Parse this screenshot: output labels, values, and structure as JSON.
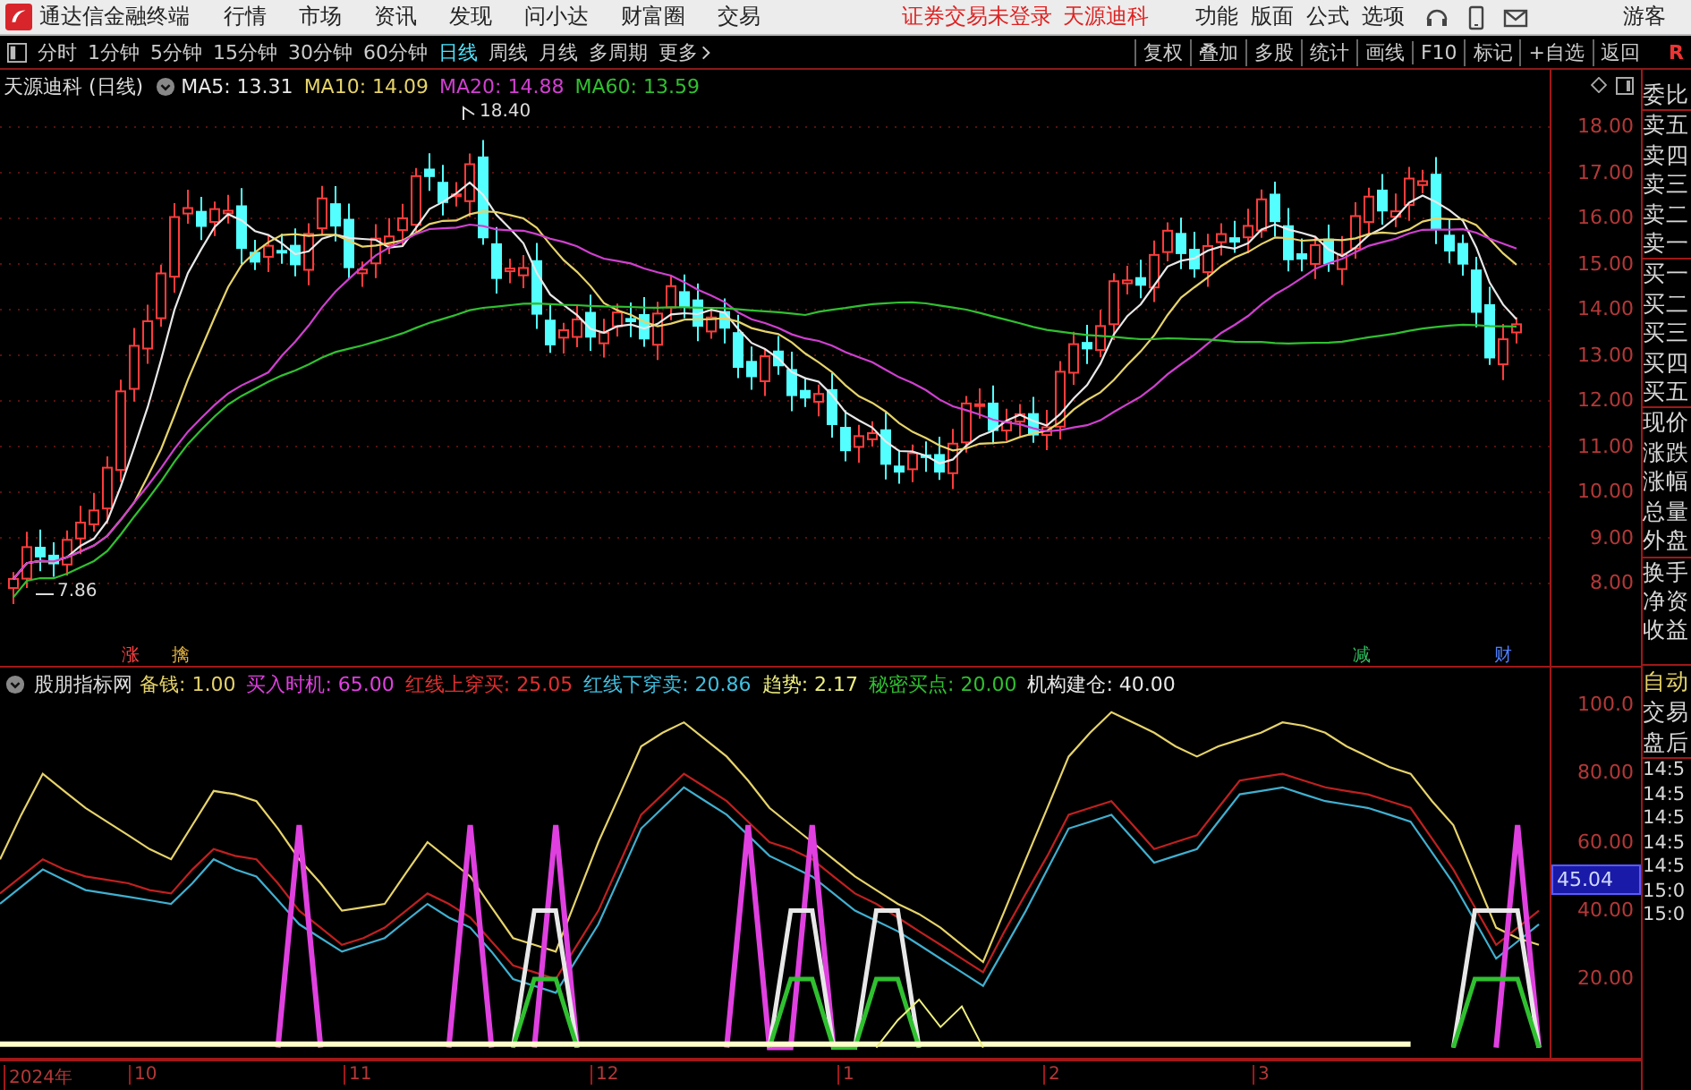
{
  "menu_bar": {
    "app_title": "通达信金融终端",
    "menus": [
      "行情",
      "市场",
      "资讯",
      "发现",
      "问小达",
      "财富圈",
      "交易"
    ],
    "notices": [
      "证券交易未登录",
      "天源迪科"
    ],
    "right_menus": [
      "功能",
      "版面",
      "公式",
      "选项"
    ],
    "user": "游客"
  },
  "period_bar": {
    "periods": [
      {
        "label": "分时",
        "selected": false
      },
      {
        "label": "1分钟",
        "selected": false
      },
      {
        "label": "5分钟",
        "selected": false
      },
      {
        "label": "15分钟",
        "selected": false
      },
      {
        "label": "30分钟",
        "selected": false
      },
      {
        "label": "60分钟",
        "selected": false
      },
      {
        "label": "日线",
        "selected": true
      },
      {
        "label": "周线",
        "selected": false
      },
      {
        "label": "月线",
        "selected": false
      },
      {
        "label": "多周期",
        "selected": false
      }
    ],
    "more": "更多",
    "tools": [
      "复权",
      "叠加",
      "多股",
      "统计",
      "画线",
      "F10",
      "标记",
      "+自选",
      "返回"
    ],
    "badge": "R"
  },
  "price_chart": {
    "title": "天源迪科 (日线)",
    "mas": [
      {
        "label": "MA5: 13.31",
        "color": "#e8e8e8"
      },
      {
        "label": "MA10: 14.09",
        "color": "#e6d36a"
      },
      {
        "label": "MA20: 14.88",
        "color": "#d040d0"
      },
      {
        "label": "MA60: 13.59",
        "color": "#30c030"
      }
    ],
    "high_label": "18.40",
    "low_label": "7.86",
    "y_ticks": [
      "18.00",
      "17.00",
      "16.00",
      "15.00",
      "14.00",
      "13.00",
      "12.00",
      "11.00",
      "10.00",
      "9.00",
      "8.00"
    ],
    "markers": [
      {
        "text": "涨",
        "color": "#ff4040"
      },
      {
        "text": "擒",
        "color": "#e0b040"
      },
      {
        "text": "减",
        "color": "#30c060"
      },
      {
        "text": "财",
        "color": "#5080ff"
      }
    ]
  },
  "indicator": {
    "title": "股朋指标网",
    "values": [
      {
        "label": "备钱: 1.00",
        "color": "#e6d36a"
      },
      {
        "label": "买入时机: 65.00",
        "color": "#e040e0"
      },
      {
        "label": "红线上穿买: 25.05",
        "color": "#e03030"
      },
      {
        "label": "红线下穿卖: 20.86",
        "color": "#40c0e0"
      },
      {
        "label": "趋势: 2.17",
        "color": "#f0f080"
      },
      {
        "label": "秘密买点: 20.00",
        "color": "#30c030"
      },
      {
        "label": "机构建仓: 40.00",
        "color": "#e8e8e8"
      }
    ],
    "current": "45.04",
    "chart_data": {
      "type": "line",
      "ylim": [
        -3,
        101.6
      ],
      "categories": [
        null,
        null,
        null,
        null,
        null,
        null,
        null,
        null,
        null,
        null,
        null,
        null,
        null,
        null,
        null,
        null,
        null,
        null,
        null,
        null,
        null,
        null,
        null,
        null,
        null,
        null,
        null,
        null,
        null,
        null,
        null,
        null,
        null,
        null,
        null,
        null,
        null,
        null,
        null,
        null,
        null,
        null,
        null,
        null,
        null,
        null,
        null,
        null,
        null,
        null,
        null,
        null,
        null,
        null,
        null,
        null,
        null,
        null,
        null,
        null,
        null,
        null,
        null,
        null,
        null,
        null,
        null,
        null,
        null,
        null,
        null,
        null,
        null
      ],
      "yticks": [
        {
          "value": 100,
          "label": "100.0"
        },
        {
          "value": 80,
          "label": "80.00"
        },
        {
          "value": 60,
          "label": "60.00"
        },
        {
          "value": 40,
          "label": "40.00"
        },
        {
          "value": 20,
          "label": "20.00"
        }
      ],
      "series": [
        {
          "color": "#e6d36a",
          "values": [
            55,
            68,
            80,
            75,
            70,
            66,
            62,
            58,
            55,
            65,
            75,
            74,
            72,
            64,
            55,
            48,
            40,
            41,
            42,
            51,
            60,
            55,
            50,
            41,
            32,
            30,
            28,
            44,
            60,
            74,
            88,
            92,
            95,
            90,
            85,
            78,
            70,
            65,
            60,
            55,
            50,
            46,
            42,
            39,
            35,
            30,
            25,
            40,
            55,
            70,
            85,
            92,
            98,
            95,
            92,
            88,
            85,
            88,
            90,
            92,
            95,
            94,
            92,
            88,
            85,
            82,
            80,
            72,
            65,
            50,
            35,
            32,
            30
          ]
        },
        {
          "color": "#c02020",
          "values": [
            45,
            50,
            55,
            52,
            50,
            49,
            48,
            46,
            45,
            52,
            58,
            56,
            55,
            48,
            40,
            35,
            30,
            32,
            35,
            40,
            45,
            42,
            38,
            31,
            24,
            22,
            20,
            30,
            40,
            54,
            68,
            74,
            80,
            76,
            72,
            66,
            60,
            58,
            55,
            50,
            45,
            42,
            38,
            34,
            30,
            26,
            22,
            34,
            45,
            56,
            68,
            70,
            72,
            65,
            58,
            60,
            62,
            70,
            78,
            79,
            80,
            78,
            76,
            75,
            74,
            72,
            70,
            61,
            52,
            41,
            30,
            35,
            40
          ]
        },
        {
          "color": "#40b0d0",
          "values": [
            42,
            47,
            52,
            49,
            46,
            45,
            44,
            43,
            42,
            48,
            55,
            52,
            50,
            43,
            36,
            32,
            28,
            30,
            32,
            37,
            42,
            38,
            35,
            28,
            20,
            18,
            16,
            26,
            36,
            50,
            64,
            70,
            76,
            72,
            68,
            62,
            56,
            53,
            50,
            45,
            40,
            37,
            34,
            30,
            26,
            22,
            18,
            29,
            40,
            52,
            64,
            66,
            68,
            61,
            54,
            56,
            58,
            66,
            74,
            75,
            76,
            74,
            72,
            71,
            70,
            68,
            66,
            57,
            48,
            37,
            26,
            31,
            36
          ]
        },
        {
          "color": "#e040e0",
          "values": [
            null,
            null,
            null,
            null,
            null,
            null,
            null,
            null,
            null,
            null,
            null,
            null,
            null,
            0,
            65,
            0,
            null,
            null,
            null,
            null,
            null,
            0,
            65,
            0,
            null,
            0,
            65,
            0,
            null,
            null,
            null,
            null,
            null,
            null,
            0,
            65,
            0,
            0,
            65,
            0,
            null,
            null,
            null,
            null,
            null,
            null,
            null,
            null,
            null,
            null,
            null,
            null,
            null,
            null,
            null,
            null,
            null,
            null,
            null,
            null,
            null,
            null,
            null,
            null,
            null,
            null,
            null,
            null,
            null,
            null,
            0,
            65,
            0
          ]
        },
        {
          "color": "#e8e8e8",
          "values": [
            null,
            null,
            null,
            null,
            null,
            null,
            null,
            null,
            null,
            null,
            null,
            null,
            null,
            null,
            null,
            null,
            null,
            null,
            null,
            null,
            null,
            null,
            null,
            null,
            0,
            40,
            40,
            0,
            null,
            null,
            null,
            null,
            null,
            null,
            null,
            null,
            0,
            40,
            40,
            0,
            0,
            40,
            40,
            0,
            null,
            null,
            null,
            null,
            null,
            null,
            null,
            null,
            null,
            null,
            null,
            null,
            null,
            null,
            null,
            null,
            null,
            null,
            null,
            null,
            null,
            null,
            null,
            null,
            0,
            40,
            40,
            40,
            0
          ]
        },
        {
          "color": "#30c030",
          "values": [
            null,
            null,
            null,
            null,
            null,
            null,
            null,
            null,
            null,
            null,
            null,
            null,
            null,
            null,
            null,
            null,
            null,
            null,
            null,
            null,
            null,
            null,
            null,
            null,
            0,
            20,
            20,
            0,
            null,
            null,
            null,
            null,
            null,
            null,
            null,
            null,
            0,
            20,
            20,
            0,
            0,
            20,
            20,
            0,
            null,
            null,
            null,
            null,
            null,
            null,
            null,
            null,
            null,
            null,
            null,
            null,
            null,
            null,
            null,
            null,
            null,
            null,
            null,
            null,
            null,
            null,
            null,
            null,
            0,
            20,
            20,
            20,
            0
          ]
        },
        {
          "color": "#ffffc8",
          "values": [
            1,
            1,
            1,
            1,
            1,
            1,
            1,
            1,
            1,
            1,
            1,
            1,
            1,
            1,
            1,
            1,
            1,
            1,
            1,
            1,
            1,
            1,
            1,
            1,
            1,
            1,
            1,
            1,
            1,
            1,
            1,
            1,
            1,
            1,
            1,
            1,
            1,
            1,
            1,
            1,
            1,
            1,
            1,
            1,
            1,
            1,
            1,
            1,
            1,
            1,
            1,
            1,
            1,
            1,
            1,
            1,
            1,
            1,
            1,
            1,
            1,
            1,
            1,
            1,
            1,
            1,
            1,
            null,
            null,
            null,
            null,
            null,
            null
          ]
        },
        {
          "color": "#f0f080",
          "values": [
            null,
            null,
            null,
            null,
            null,
            null,
            null,
            null,
            null,
            null,
            null,
            null,
            null,
            null,
            null,
            null,
            null,
            null,
            null,
            null,
            null,
            null,
            null,
            null,
            null,
            null,
            null,
            null,
            null,
            null,
            null,
            null,
            null,
            null,
            null,
            null,
            null,
            null,
            null,
            null,
            null,
            0,
            8,
            14,
            6,
            12,
            0,
            null,
            null,
            null,
            null,
            null,
            null,
            null,
            null,
            null,
            null,
            null,
            null,
            null,
            null,
            null,
            null,
            null,
            null,
            null,
            null,
            null,
            null,
            null,
            null,
            null,
            null
          ]
        }
      ]
    }
  },
  "time_axis": [
    "2024年",
    "10",
    "11",
    "12",
    "1",
    "2",
    "3"
  ],
  "quote_panel": {
    "fields": [
      "委比",
      "卖五",
      "卖四",
      "卖三",
      "卖二",
      "卖一",
      "买一",
      "买二",
      "买三",
      "买四",
      "买五",
      "现价",
      "涨跌",
      "涨幅",
      "总量",
      "外盘",
      "换手",
      "净资",
      "收益"
    ],
    "tabs": [
      {
        "label": "自动",
        "selected": true
      },
      {
        "label": "交易",
        "selected": false
      },
      {
        "label": "盘后",
        "selected": false
      }
    ],
    "times": [
      "14:5",
      "14:5",
      "14:5",
      "14:5",
      "14:5",
      "15:0",
      "15:0"
    ]
  }
}
